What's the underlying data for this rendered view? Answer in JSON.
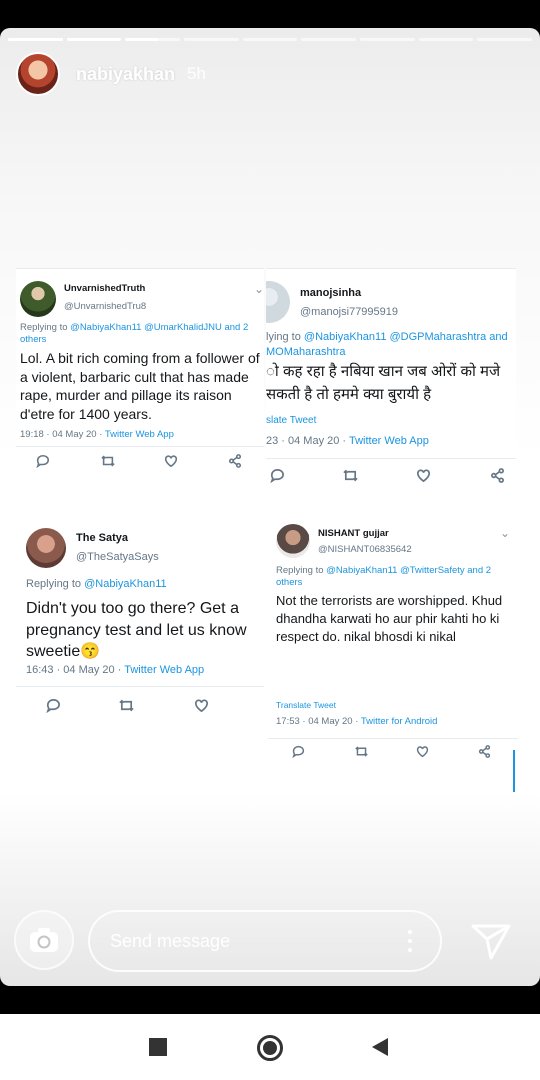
{
  "story": {
    "username": "nabiyakhan",
    "time": "5h",
    "segments": [
      1,
      1,
      0.6,
      0,
      0,
      0,
      0,
      0,
      0
    ]
  },
  "tweets": [
    {
      "name": "UnvarnishedTruth",
      "handle": "@UnvarnishedTru8",
      "reply_prefix": "Replying to ",
      "reply_to": "@NabiyaKhan11 @UmarKhalidJNU and 2 others",
      "body": "Lol. A bit rich coming from a follower of a violent, barbaric cult that has made rape, murder and pillage its raison d'etre for 1400 years.",
      "meta_time": "19:18 · 04 May 20 · ",
      "meta_source": "Twitter Web App"
    },
    {
      "name": "manojsinha",
      "handle": "@manojsi77995919",
      "reply_prefix": "lying to ",
      "reply_to": "@NabiyaKhan11 @DGPMaharashtra and MOMaharashtra",
      "body": "ो कह रहा है नबिया खान जब ओरों को मजे सकती है तो हममे क्या बुरायी है",
      "translate": "slate Tweet",
      "meta_time": "23 · 04 May 20 · ",
      "meta_source": "Twitter Web App"
    },
    {
      "name": "The Satya",
      "handle": "@TheSatyaSays",
      "reply_prefix": "Replying to ",
      "reply_to": "@NabiyaKhan11",
      "body": "Didn't you too go there? Get a pregnancy test and let us know sweetie😙",
      "meta_time": "16:43 · 04 May 20 · ",
      "meta_source": "Twitter Web App"
    },
    {
      "name": "NISHANT gujjar",
      "handle": "@NISHANT06835642",
      "reply_prefix": "Replying to ",
      "reply_to": "@NabiyaKhan11 @TwitterSafety and 2 others",
      "body": "Not the terrorists are worshipped. Khud dhandha karwati ho aur phir kahti ho ki respect do. nikal bhosdi ki nikal",
      "translate": "Translate Tweet",
      "meta_time": "17:53 · 04 May 20 · ",
      "meta_source": "Twitter for Android"
    }
  ],
  "composer": {
    "placeholder": "Send message",
    "camera_icon": "camera-icon",
    "send_icon": "send-icon",
    "more_icon": "more-vertical-icon"
  },
  "navbar": {
    "recents_icon": "square-icon",
    "home_icon": "circle-icon",
    "back_icon": "triangle-back-icon"
  },
  "colors": {
    "twitter_link": "#1b95e0",
    "twitter_secondary": "#657786",
    "twitter_text": "#14171a"
  }
}
